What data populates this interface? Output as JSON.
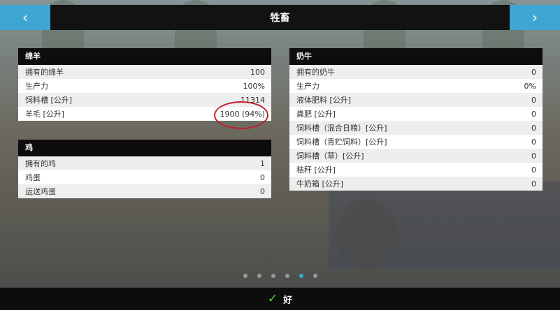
{
  "header": {
    "title": "牲畜",
    "prev_icon": "‹",
    "next_icon": "›"
  },
  "sheep": {
    "title": "绵羊",
    "rows": [
      {
        "label": "拥有的绵羊",
        "value": "100"
      },
      {
        "label": "生产力",
        "value": "100%"
      },
      {
        "label": "饲料槽 [公升]",
        "value": "11314"
      },
      {
        "label": "羊毛 [公升]",
        "value": "1900 (94%)"
      }
    ]
  },
  "chickens": {
    "title": "鸡",
    "rows": [
      {
        "label": "拥有的鸡",
        "value": "1"
      },
      {
        "label": "鸡蛋",
        "value": "0"
      },
      {
        "label": "运送鸡蛋",
        "value": "0"
      }
    ]
  },
  "cows": {
    "title": "奶牛",
    "rows": [
      {
        "label": "拥有的奶牛",
        "value": "0"
      },
      {
        "label": "生产力",
        "value": "0%"
      },
      {
        "label": "液体肥料 [公升]",
        "value": "0"
      },
      {
        "label": "粪肥 [公升]",
        "value": "0"
      },
      {
        "label": "饲料槽（混合日粮）[公升]",
        "value": "0"
      },
      {
        "label": "饲料槽（青贮饲料）[公升]",
        "value": "0"
      },
      {
        "label": "饲料槽（草）[公升]",
        "value": "0"
      },
      {
        "label": "秸秆 [公升]",
        "value": "0"
      },
      {
        "label": "牛奶箱 [公升]",
        "value": "0"
      }
    ]
  },
  "pager": {
    "count": 6,
    "active_index": 4
  },
  "footer": {
    "ok_label": "好",
    "ok_icon": "✓"
  },
  "colors": {
    "accent": "#3fa6d3",
    "highlight_ring": "#c0202a",
    "check": "#5fc04a"
  }
}
